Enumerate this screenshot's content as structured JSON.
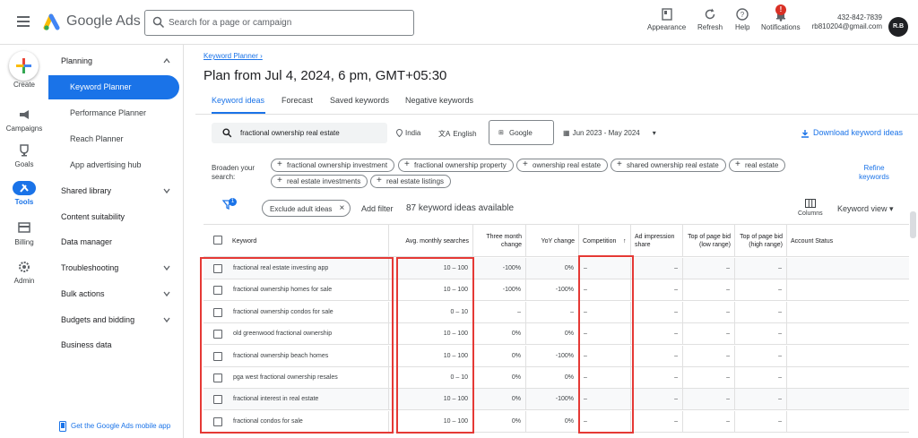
{
  "header": {
    "brand": "Google Ads",
    "search_placeholder": "Search for a page or campaign",
    "buttons": [
      {
        "label": "Appearance",
        "icon": "appearance-icon"
      },
      {
        "label": "Refresh",
        "icon": "refresh-icon"
      },
      {
        "label": "Help",
        "icon": "help-icon"
      },
      {
        "label": "Notifications",
        "icon": "bell-icon"
      }
    ],
    "notification_count": "!",
    "account_id": "432-842-7839",
    "account_email": "rb810204@gmail.com",
    "avatar_initials": "R.B"
  },
  "rail": [
    {
      "label": "Create",
      "icon": "plus-icon"
    },
    {
      "label": "Campaigns",
      "icon": "megaphone-icon"
    },
    {
      "label": "Goals",
      "icon": "trophy-icon"
    },
    {
      "label": "Tools",
      "icon": "tools-icon"
    },
    {
      "label": "Billing",
      "icon": "card-icon"
    },
    {
      "label": "Admin",
      "icon": "gear-icon"
    }
  ],
  "sidenav": {
    "planning": "Planning",
    "planning_items": [
      "Keyword Planner",
      "Performance Planner",
      "Reach Planner",
      "App advertising hub"
    ],
    "sections": [
      "Shared library",
      "Content suitability",
      "Data manager",
      "Troubleshooting",
      "Bulk actions",
      "Budgets and bidding",
      "Business data"
    ],
    "mobile_link": "Get the Google Ads mobile app"
  },
  "main": {
    "breadcrumb": "Keyword Planner",
    "title": "Plan from Jul 4, 2024, 6 pm, GMT+05:30",
    "tabs": [
      "Keyword ideas",
      "Forecast",
      "Saved keywords",
      "Negative keywords"
    ],
    "search_term": "fractional ownership real estate",
    "location": "India",
    "language": "English",
    "network": "Google",
    "date_range": "Jun 2023 - May 2024",
    "download": "Download keyword ideas",
    "broaden_label": "Broaden your search:",
    "broaden_chips": [
      "fractional ownership investment",
      "fractional ownership property",
      "ownership real estate",
      "shared ownership real estate",
      "real estate",
      "real estate investments",
      "real estate listings"
    ],
    "refine": "Refine keywords",
    "filter_badge": "1",
    "exclude_chip": "Exclude adult ideas",
    "add_filter": "Add filter",
    "count": "87 keyword ideas available",
    "columns_label": "Columns",
    "keyword_view": "Keyword view"
  },
  "table": {
    "headers": [
      "Keyword",
      "Avg. monthly searches",
      "Three month change",
      "YoY change",
      "Competition",
      "Ad impression share",
      "Top of page bid (low range)",
      "Top of page bid (high range)",
      "Account Status"
    ],
    "rows": [
      [
        "fractional real estate investing app",
        "10 – 100",
        "-100%",
        "0%",
        "–",
        "–",
        "–",
        "–",
        ""
      ],
      [
        "fractional ownership homes for sale",
        "10 – 100",
        "-100%",
        "-100%",
        "–",
        "–",
        "–",
        "–",
        ""
      ],
      [
        "fractional ownership condos for sale",
        "0 – 10",
        "–",
        "–",
        "–",
        "–",
        "–",
        "–",
        ""
      ],
      [
        "old greenwood fractional ownership",
        "10 – 100",
        "0%",
        "0%",
        "–",
        "–",
        "–",
        "–",
        ""
      ],
      [
        "fractional ownership beach homes",
        "10 – 100",
        "0%",
        "-100%",
        "–",
        "–",
        "–",
        "–",
        ""
      ],
      [
        "pga west fractional ownership resales",
        "0 – 10",
        "0%",
        "0%",
        "–",
        "–",
        "–",
        "–",
        ""
      ],
      [
        "fractional interest in real estate",
        "10 – 100",
        "0%",
        "-100%",
        "–",
        "–",
        "–",
        "–",
        ""
      ],
      [
        "fractional condos for sale",
        "10 – 100",
        "0%",
        "0%",
        "–",
        "–",
        "–",
        "–",
        ""
      ]
    ]
  },
  "colors": {
    "accent": "#1a73e8",
    "highlight": "#e53935"
  }
}
